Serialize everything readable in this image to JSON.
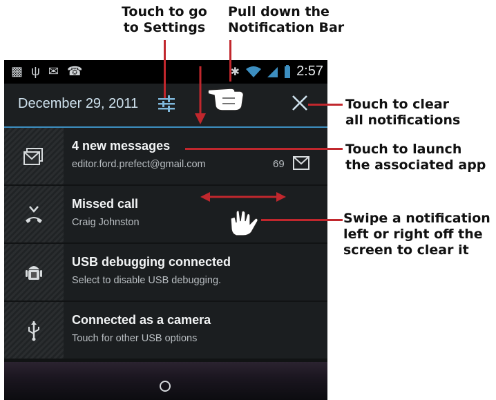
{
  "callouts": {
    "settings": [
      "Touch to go",
      "to Settings"
    ],
    "pull": [
      "Pull down the",
      "Notification Bar"
    ],
    "clear": [
      "Touch to clear",
      "all notifications"
    ],
    "launch": [
      "Touch to launch",
      "the associated app"
    ],
    "swipe": [
      "Swipe a notification",
      "left or right off the",
      "screen to clear it"
    ]
  },
  "status_bar": {
    "time": "2:57"
  },
  "header": {
    "date": "December 29, 2011"
  },
  "notifications": [
    {
      "title": "4 new messages",
      "subtitle": "editor.ford.prefect@gmail.com",
      "count": "69",
      "icon": "gmail-stack-icon"
    },
    {
      "title": "Missed call",
      "subtitle": "Craig Johnston",
      "icon": "missed-call-icon"
    },
    {
      "title": "USB debugging connected",
      "subtitle": "Select to disable USB debugging.",
      "icon": "android-debug-icon"
    },
    {
      "title": "Connected as a camera",
      "subtitle": "Touch for other USB options",
      "icon": "usb-icon"
    }
  ],
  "colors": {
    "accent_blue": "#3d8fc1",
    "callout_red": "#c1272d"
  }
}
